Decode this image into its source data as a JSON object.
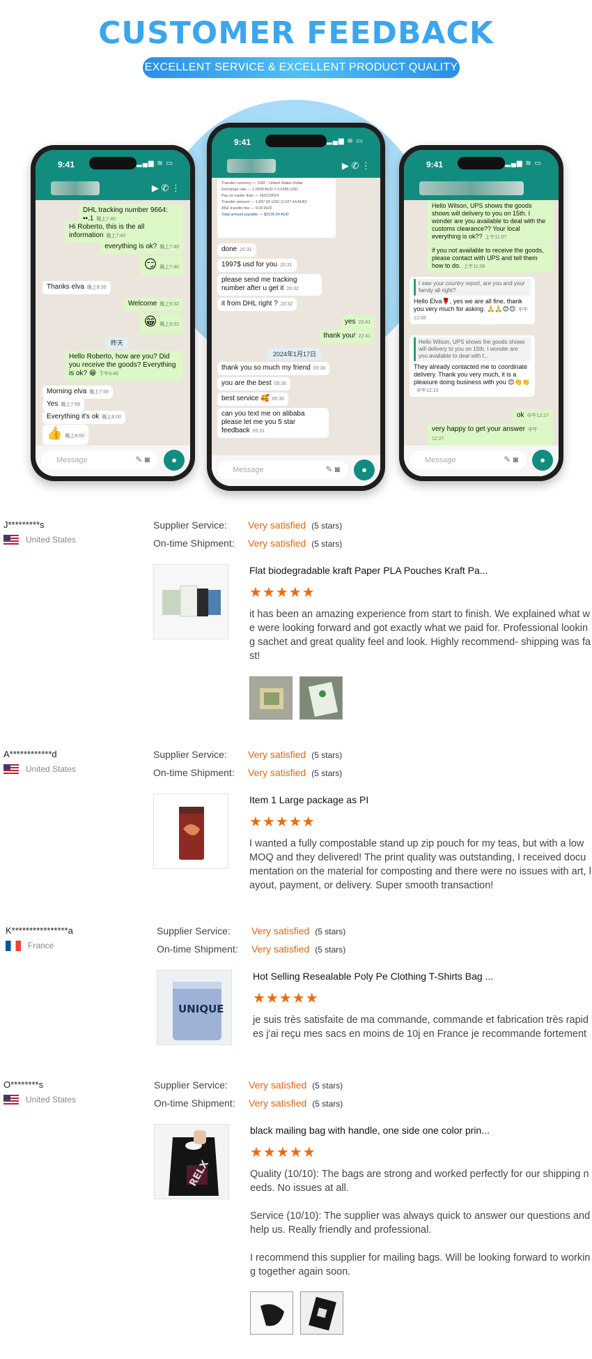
{
  "header": {
    "title": "CUSTOMER FEEDBACK",
    "subtitle": "EXCELLENT SERVICE & EXCELLENT PRODUCT QUALITY"
  },
  "phones": [
    {
      "time": "9:41",
      "input_placeholder": "Message",
      "messages": [
        {
          "dir": "out",
          "text": "DHL tracking number 9664: ▪▪.1",
          "time": "晚上7:40"
        },
        {
          "dir": "out",
          "text": "Hi Roberto, this is the all information",
          "time": "晚上7:40"
        },
        {
          "dir": "out",
          "text": "everything is ok?",
          "time": "晚上7:40"
        },
        {
          "dir": "out",
          "text": "😏",
          "time": "晚上7:40"
        },
        {
          "dir": "in",
          "text": "Thanks elva",
          "time": "晚上8:35"
        },
        {
          "dir": "out",
          "text": "Welcome",
          "time": "晚上9:32"
        },
        {
          "dir": "out",
          "text": "😁",
          "time": "晚上9:32"
        },
        {
          "dir": "chip",
          "text": "昨天"
        },
        {
          "dir": "out",
          "text": "Hello Roberto, how are you? Did you receive the goods? Everything is ok? 😁",
          "time": "下午6:46"
        },
        {
          "dir": "in",
          "text": "Morning elva",
          "time": "晚上7:59"
        },
        {
          "dir": "in",
          "text": "Yes",
          "time": "晚上7:59"
        },
        {
          "dir": "in",
          "text": "Everything it's ok",
          "time": "晚上8:00"
        },
        {
          "dir": "in",
          "text": "👍",
          "time": "晚上8:00"
        }
      ]
    },
    {
      "time": "9:41",
      "input_placeholder": "Message",
      "document_rows": [
        [
          "Transfer currency",
          "USD - United States Dollar"
        ],
        [
          "Exchange rate",
          "1.0000 AUD = 0.6385 USD"
        ],
        [
          "Pay no earlier than",
          "16/01/2024"
        ],
        [
          "Transfer amount",
          "1,997.00 USD (1,527.64 AUD)"
        ],
        [
          "ANZ transfer fee",
          "9.00 AUD"
        ],
        [
          "Total amount payable",
          "$3136.64 AUD"
        ]
      ],
      "messages": [
        {
          "dir": "in",
          "text": "done",
          "time": "20:31"
        },
        {
          "dir": "in",
          "text": "1997$ usd for you",
          "time": "20:31"
        },
        {
          "dir": "in",
          "text": "please send me tracking number after u get it",
          "time": "20:32"
        },
        {
          "dir": "in",
          "text": "it from DHL right ?",
          "time": "20:32"
        },
        {
          "dir": "out",
          "text": "yes",
          "time": "22:41"
        },
        {
          "dir": "out",
          "text": "thank you!",
          "time": "22:41"
        },
        {
          "dir": "chip",
          "text": "2024年1月17日"
        },
        {
          "dir": "in",
          "text": "thank you so much my friend",
          "time": "05:30"
        },
        {
          "dir": "in",
          "text": "you are the best",
          "time": "05:30"
        },
        {
          "dir": "in",
          "text": "best service 🥰",
          "time": "05:30"
        },
        {
          "dir": "in",
          "text": "can you text me on alibaba please let me you 5 star feedback",
          "time": "05:31"
        }
      ]
    },
    {
      "time": "9:41",
      "input_placeholder": "Message",
      "messages": [
        {
          "dir": "out",
          "text": "Hello Wilson, UPS shows the goods shows will delivery to you on 15th. I wonder are you available to deal with the customs clearance?? Your local everything is ok??",
          "time": "上午11:07"
        },
        {
          "dir": "out",
          "text": "if you not available to receive the goods, please contact with UPS and tell them how to do.",
          "time": "上午11:08"
        },
        {
          "dir": "in",
          "quote": "I saw your country report, are you and your family all right?",
          "text": "Hello Elva🌹, yes we are all fine, thank you very much for asking. 🙏🙏😊😊",
          "time": "中午12:08"
        },
        {
          "dir": "in",
          "quote": "Hello Wilson, UPS shows the goods shows will delivery to you on 15th. I wonder are you available to deal with t...",
          "text": "They already contacted me to coordinate delivery. Thank you very much, it is a pleasure doing business with you 😊👏👏",
          "time": "中午12:10"
        },
        {
          "dir": "out",
          "text": "ok",
          "time": "中午12:27"
        },
        {
          "dir": "out",
          "text": "very happy to get your answer",
          "time": "中午12:27"
        }
      ]
    }
  ],
  "reviews": [
    {
      "name": "J*********s",
      "country": "United States",
      "flag": "us",
      "supplier_service_label": "Supplier Service:",
      "supplier_service_value": "Very satisfied",
      "supplier_service_stars": "(5 stars)",
      "shipment_label": "On-time Shipment:",
      "shipment_value": "Very satisfied",
      "shipment_stars": "(5 stars)",
      "product_title": "Flat biodegradable kraft Paper PLA Pouches Kraft Pa...",
      "rating": 5,
      "stars_text": "★★★★★",
      "text": [
        "it has been an amazing experience from start to finish. We explained what we were looking forward and got exactly what we paid for. Professional looking sachet and great quality feel and look. Highly recommend- shipping was fast!"
      ],
      "photos": 2
    },
    {
      "name": "A************d",
      "country": "United States",
      "flag": "us",
      "supplier_service_label": "Supplier Service:",
      "supplier_service_value": "Very satisfied",
      "supplier_service_stars": "(5 stars)",
      "shipment_label": "On-time Shipment:",
      "shipment_value": "Very satisfied",
      "shipment_stars": "(5 stars)",
      "product_title": "Item 1 Large package as PI",
      "rating": 5,
      "stars_text": "★★★★★",
      "text": [
        "I wanted a fully compostable stand up zip pouch for my teas, but with a low MOQ and they delivered! The print quality was outstanding, I received documentation on the material for composting and there were no issues with art, layout, payment, or delivery. Super smooth transaction!"
      ],
      "photos": 0
    },
    {
      "name": "K****************a",
      "country": "France",
      "flag": "fr",
      "supplier_service_label": "Supplier Service:",
      "supplier_service_value": "Very satisfied",
      "supplier_service_stars": "(5 stars)",
      "shipment_label": "On-time Shipment:",
      "shipment_value": "Very satisfied",
      "shipment_stars": "(5 stars)",
      "product_title": "Hot Selling Resealable Poly Pe Clothing T-Shirts Bag ...",
      "product_image_label": "UNIQUE",
      "rating": 5,
      "stars_text": "★★★★★",
      "text": [
        "je suis très satisfaite de ma commande, commande et fabrication très rapides j'ai reçu mes sacs en moins de 10j en France je recommande fortement"
      ],
      "photos": 0
    },
    {
      "name": "O********s",
      "country": "United States",
      "flag": "us",
      "supplier_service_label": "Supplier Service:",
      "supplier_service_value": "Very satisfied",
      "supplier_service_stars": "(5 stars)",
      "shipment_label": "On-time Shipment:",
      "shipment_value": "Very satisfied",
      "shipment_stars": "(5 stars)",
      "product_title": "black mailing bag with handle, one side one color prin...",
      "product_image_label": "RELX",
      "rating": 5,
      "stars_text": "★★★★★",
      "text": [
        "Quality (10/10): The bags are strong and worked perfectly for our shipping needs. No issues at all.",
        "Service (10/10): The supplier was always quick to answer our questions and help us. Really friendly and professional.",
        "I recommend this supplier for mailing bags. Will be looking forward to working together again soon."
      ],
      "photos": 2
    }
  ]
}
